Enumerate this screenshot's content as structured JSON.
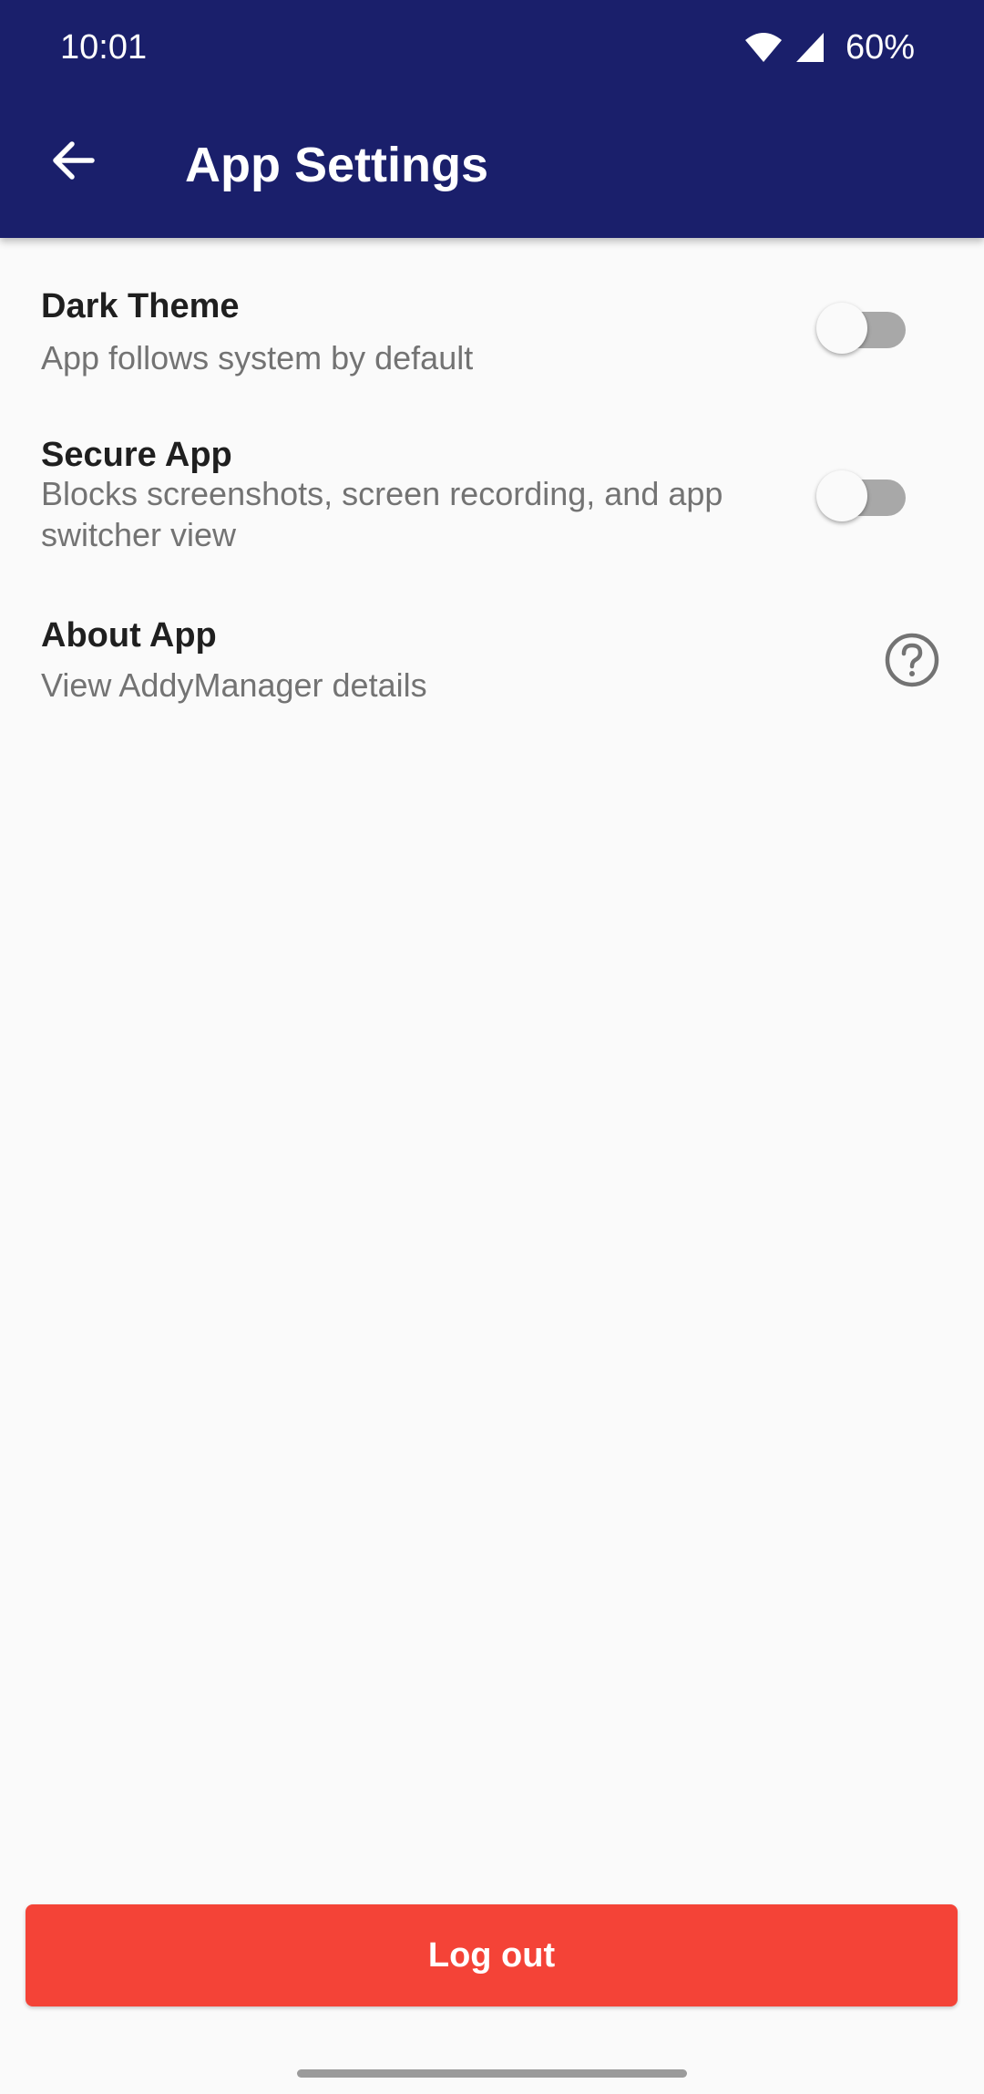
{
  "status_bar": {
    "time": "10:01",
    "battery": "60%",
    "icons": [
      "wifi-icon",
      "cellular-signal-icon"
    ]
  },
  "header": {
    "back_icon": "arrow-left-icon",
    "title": "App Settings"
  },
  "settings": [
    {
      "title": "Dark Theme",
      "description": "App follows system by default",
      "control": "switch",
      "checked": false
    },
    {
      "title": "Secure App",
      "description": "Blocks screenshots, screen recording, and app switcher view",
      "control": "switch",
      "checked": false
    },
    {
      "title": "About App",
      "description": "View AddyManager details",
      "control": "icon",
      "icon": "help-circle-icon"
    }
  ],
  "logout_label": "Log out",
  "colors": {
    "app_bar": "#1a1f6b",
    "background": "#fafafa",
    "logout_button": "#f44337",
    "switch_track_off": "#a8a8a8",
    "secondary_text": "#737373"
  }
}
